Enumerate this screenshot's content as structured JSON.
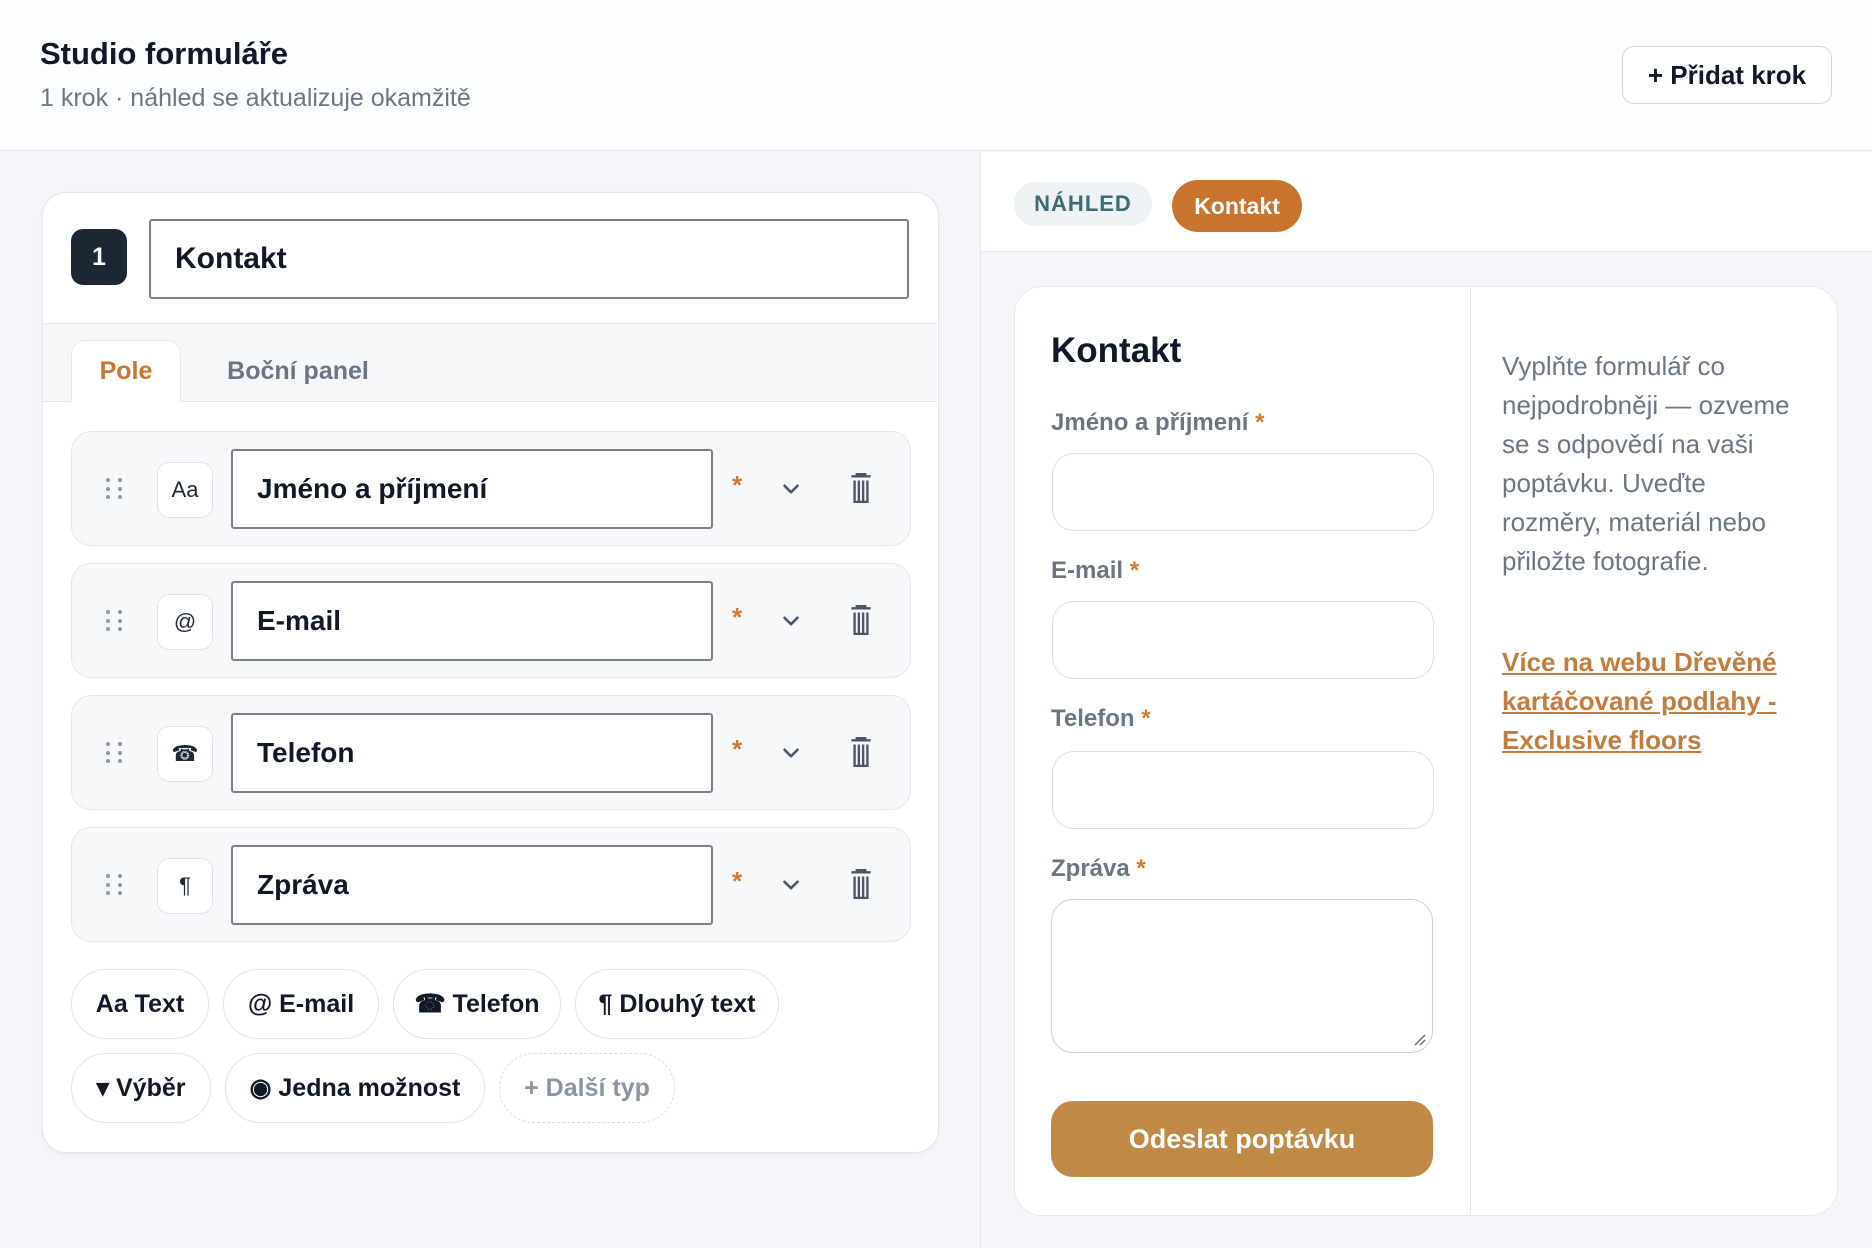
{
  "header": {
    "title": "Studio formuláře",
    "subtitle": "1 krok · náhled se aktualizuje okamžitě",
    "add_step_label": "+ Přidat krok"
  },
  "editor": {
    "step_number": "1",
    "step_title": "Kontakt",
    "tabs": [
      {
        "label": "Pole",
        "active": true
      },
      {
        "label": "Boční panel",
        "active": false
      }
    ],
    "fields": [
      {
        "type_icon": "Aa",
        "icon_name": "text-type-icon",
        "label": "Jméno a příjmení",
        "required": "*"
      },
      {
        "type_icon": "@",
        "icon_name": "email-type-icon",
        "label": "E-mail",
        "required": "*"
      },
      {
        "type_icon": "☎",
        "icon_name": "phone-type-icon",
        "label": "Telefon",
        "required": "*"
      },
      {
        "type_icon": "¶",
        "icon_name": "paragraph-type-icon",
        "label": "Zpráva",
        "required": "*"
      }
    ],
    "add_chips": [
      "Aa Text",
      "@ E-mail",
      "☎ Telefon",
      "¶ Dlouhý text",
      "▾ Výběr",
      "◉ Jedna možnost",
      "+ Další typ"
    ]
  },
  "preview": {
    "badge_label": "NÁHLED",
    "step_pill": "Kontakt",
    "form_title": "Kontakt",
    "fields": [
      {
        "label": "Jméno a příjmení",
        "required": "*"
      },
      {
        "label": "E-mail",
        "required": "*"
      },
      {
        "label": "Telefon",
        "required": "*"
      },
      {
        "label": "Zpráva",
        "required": "*"
      }
    ],
    "submit_label": "Odeslat poptávku",
    "sidebar_text": "Vyplňte formulář co nejpodrobněji — ozveme se s odpovědí na vaši poptávku. Uveďte rozměry, materiál nebo přiložte fotografie.",
    "sidebar_link": "Více na webu Dřevěné kartáčované podlahy - Exclusive floors"
  },
  "colors": {
    "accent_orange": "#c8742f",
    "submit_brown": "#c08a46",
    "badge_dark": "#1c2733",
    "required_star": "#d9772b"
  }
}
